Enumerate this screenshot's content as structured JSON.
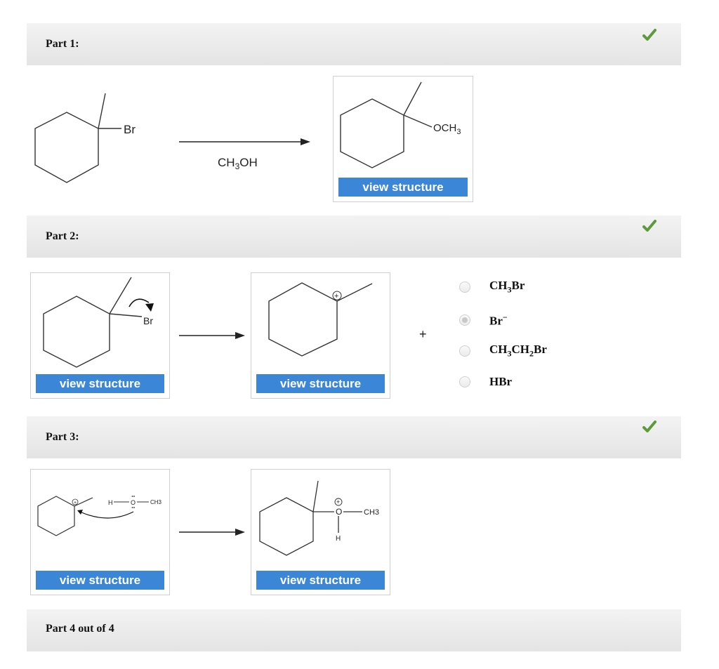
{
  "parts": [
    {
      "title": "Part 1:",
      "complete": true
    },
    {
      "title": "Part 2:",
      "complete": true
    },
    {
      "title": "Part 3:",
      "complete": true
    },
    {
      "title": "Part 4 out of 4",
      "complete": false
    }
  ],
  "part1": {
    "reactant_label": "Br",
    "reagent_base": "CH",
    "reagent_sub": "3",
    "reagent_tail": "OH",
    "product_label_base": "OCH",
    "product_label_sub": "3"
  },
  "part2": {
    "leaving_label": "Br",
    "cation_charge": "+",
    "plus_sign": "+",
    "options": [
      {
        "label": "CH3Br",
        "selected": false
      },
      {
        "label": "Br−",
        "selected": true
      },
      {
        "label": "CH3CH2Br",
        "selected": false
      },
      {
        "label": "HBr",
        "selected": false
      }
    ]
  },
  "part3": {
    "reactant_h": "H",
    "reactant_o": "O",
    "reactant_ch3": "CH3",
    "product_o": "O",
    "product_ch3": "CH3",
    "product_h": "H"
  },
  "buttons": {
    "view_structure": "view structure"
  },
  "colors": {
    "check_green": "#5c9a3a",
    "button_blue": "#3b86d6"
  }
}
